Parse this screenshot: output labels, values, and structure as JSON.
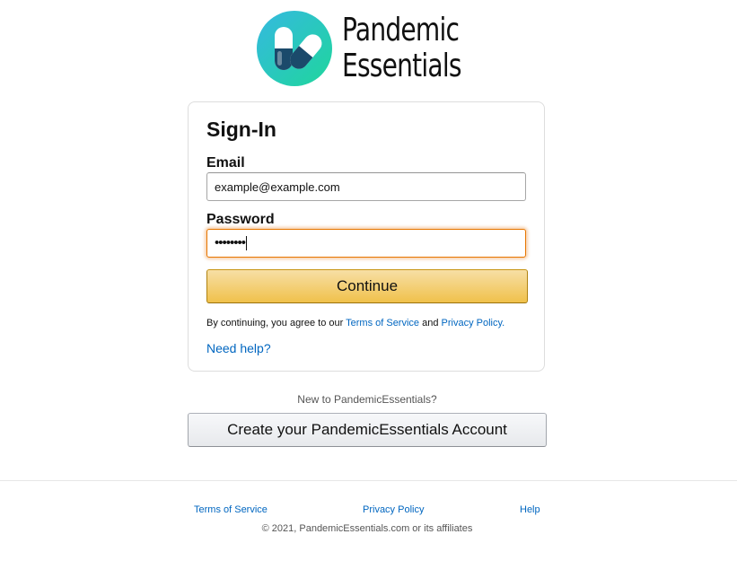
{
  "brand": {
    "name_line1": "Pandemic",
    "name_line2": "Essentials",
    "logo_icon": "pill-capsule-icon",
    "logo_gradient": [
      "#2ec5d3",
      "#20d2a0"
    ]
  },
  "signin": {
    "title": "Sign-In",
    "email_label": "Email",
    "email_value": "example@example.com",
    "password_label": "Password",
    "password_value": "••••••••",
    "continue_label": "Continue",
    "agree_prefix": "By continuing, you agree to our ",
    "tos_link": "Terms of Service",
    "agree_and": " and ",
    "privacy_link": "Privacy Policy",
    "agree_suffix": ".",
    "help_link": "Need help?"
  },
  "create": {
    "prompt": "New to PandemicEssentials?",
    "button_label": "Create your PandemicEssentials Account"
  },
  "footer": {
    "tos": "Terms of Service",
    "privacy": "Privacy Policy",
    "help": "Help",
    "copyright": "© 2021, PandemicEssentials.com or its affiliates"
  },
  "colors": {
    "link": "#0066c0",
    "continue_top": "#f7dfa5",
    "continue_bottom": "#f0c14b",
    "focus_border": "#e77600"
  }
}
